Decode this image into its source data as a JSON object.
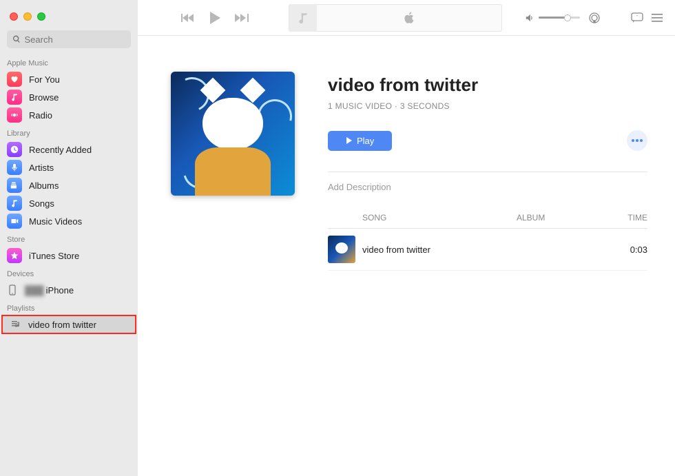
{
  "search": {
    "placeholder": "Search"
  },
  "sidebar": {
    "sections": {
      "apple_music": {
        "head": "Apple Music",
        "items": [
          "For You",
          "Browse",
          "Radio"
        ]
      },
      "library": {
        "head": "Library",
        "items": [
          "Recently Added",
          "Artists",
          "Albums",
          "Songs",
          "Music Videos"
        ]
      },
      "store": {
        "head": "Store",
        "items": [
          "iTunes Store"
        ]
      },
      "devices": {
        "head": "Devices",
        "items": [
          "iPhone"
        ],
        "device_prefix_blur": true
      },
      "playlists": {
        "head": "Playlists",
        "items": [
          "video from twitter"
        ]
      }
    }
  },
  "playlist": {
    "title": "video from twitter",
    "subtitle": "1 MUSIC VIDEO · 3 SECONDS",
    "play_label": "Play",
    "description_placeholder": "Add Description"
  },
  "table": {
    "headers": {
      "song": "SONG",
      "album": "ALBUM",
      "time": "TIME"
    },
    "rows": [
      {
        "song": "video from twitter",
        "album": "",
        "time": "0:03"
      }
    ]
  }
}
